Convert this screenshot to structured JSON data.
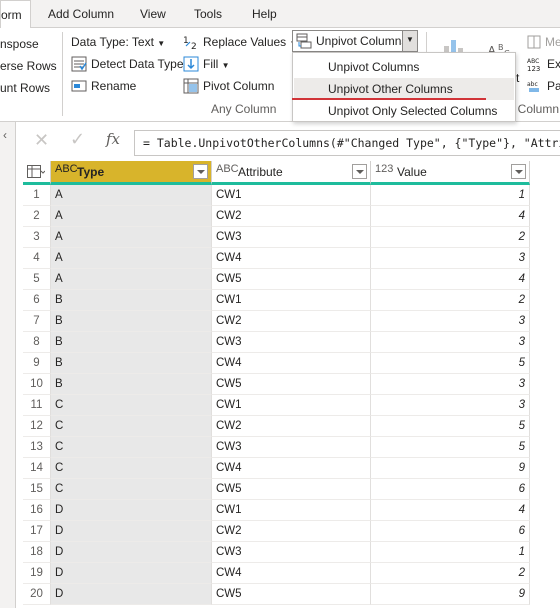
{
  "tabs": [
    {
      "label": "orm",
      "active": true
    },
    {
      "label": "Add Column",
      "active": false
    },
    {
      "label": "View",
      "active": false
    },
    {
      "label": "Tools",
      "active": false
    },
    {
      "label": "Help",
      "active": false
    }
  ],
  "ribbon": {
    "transpose": "nspose",
    "reverse_rows": "erse Rows",
    "count_rows": "unt Rows",
    "data_type": "Data Type: Text",
    "detect_data_type": "Detect Data Type",
    "rename": "Rename",
    "replace_values": "Replace Values",
    "fill": "Fill",
    "pivot_column": "Pivot Column",
    "unpivot_columns": "Unpivot Columns",
    "any_column_group": "Any Column",
    "right_me": "Me",
    "right_ext": "Ext",
    "right_par": "Par",
    "right_t": "t",
    "right_column_group": "t Column"
  },
  "menu": {
    "items": [
      {
        "label": "Unpivot Columns"
      },
      {
        "label": "Unpivot Other Columns"
      },
      {
        "label": "Unpivot Only Selected Columns"
      }
    ]
  },
  "formula": {
    "text": "= Table.UnpivotOtherColumns(#\"Changed Type\", {\"Type\"}, \"Attribu"
  },
  "table": {
    "columns": [
      {
        "type_icon": "ABC",
        "name": "Type"
      },
      {
        "type_icon": "ABC",
        "name": "Attribute"
      },
      {
        "type_icon": "123",
        "name": "Value"
      }
    ],
    "rows": [
      {
        "n": "1",
        "type": "A",
        "attr": "CW1",
        "val": "1"
      },
      {
        "n": "2",
        "type": "A",
        "attr": "CW2",
        "val": "4"
      },
      {
        "n": "3",
        "type": "A",
        "attr": "CW3",
        "val": "2"
      },
      {
        "n": "4",
        "type": "A",
        "attr": "CW4",
        "val": "3"
      },
      {
        "n": "5",
        "type": "A",
        "attr": "CW5",
        "val": "4"
      },
      {
        "n": "6",
        "type": "B",
        "attr": "CW1",
        "val": "2"
      },
      {
        "n": "7",
        "type": "B",
        "attr": "CW2",
        "val": "3"
      },
      {
        "n": "8",
        "type": "B",
        "attr": "CW3",
        "val": "3"
      },
      {
        "n": "9",
        "type": "B",
        "attr": "CW4",
        "val": "5"
      },
      {
        "n": "10",
        "type": "B",
        "attr": "CW5",
        "val": "3"
      },
      {
        "n": "11",
        "type": "C",
        "attr": "CW1",
        "val": "3"
      },
      {
        "n": "12",
        "type": "C",
        "attr": "CW2",
        "val": "5"
      },
      {
        "n": "13",
        "type": "C",
        "attr": "CW3",
        "val": "5"
      },
      {
        "n": "14",
        "type": "C",
        "attr": "CW4",
        "val": "9"
      },
      {
        "n": "15",
        "type": "C",
        "attr": "CW5",
        "val": "6"
      },
      {
        "n": "16",
        "type": "D",
        "attr": "CW1",
        "val": "4"
      },
      {
        "n": "17",
        "type": "D",
        "attr": "CW2",
        "val": "6"
      },
      {
        "n": "18",
        "type": "D",
        "attr": "CW3",
        "val": "1"
      },
      {
        "n": "19",
        "type": "D",
        "attr": "CW4",
        "val": "2"
      },
      {
        "n": "20",
        "type": "D",
        "attr": "CW5",
        "val": "9"
      }
    ]
  },
  "colors": {
    "header_accent": "#1ebc9c",
    "selected_column_header": "#d8b42b",
    "underline": "#d13438"
  }
}
